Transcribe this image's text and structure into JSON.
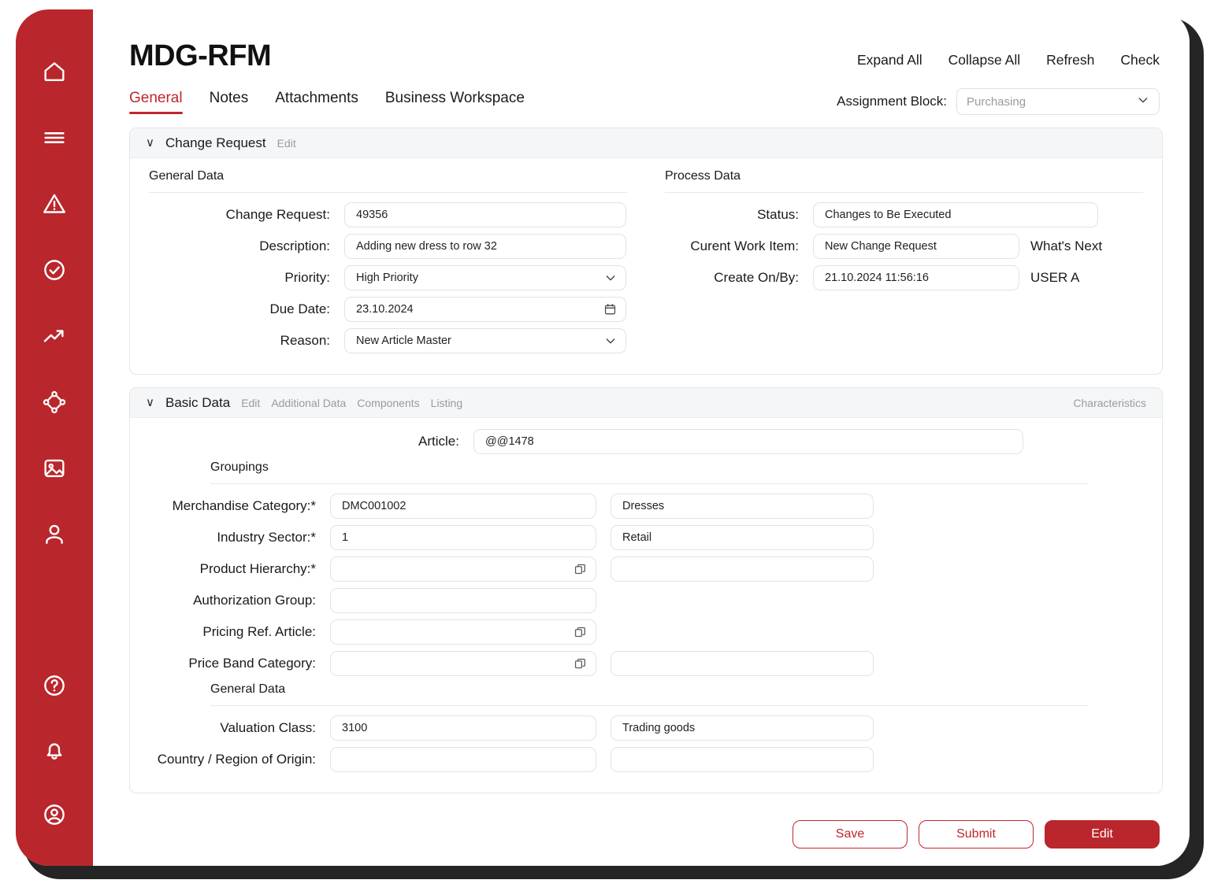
{
  "app": {
    "title": "MDG-RFM",
    "accent_color": "#b9262c",
    "sidebar_color": "#b9262c"
  },
  "sidebar": {
    "top_items": [
      {
        "icon": "home-icon",
        "name": "home"
      },
      {
        "icon": "menu-icon",
        "name": "menu"
      },
      {
        "icon": "warning-triangle-icon",
        "name": "alerts"
      },
      {
        "icon": "check-circle-icon",
        "name": "approvals"
      },
      {
        "icon": "trending-up-icon",
        "name": "analytics"
      },
      {
        "icon": "network-node-icon",
        "name": "hierarchy"
      },
      {
        "icon": "image-icon",
        "name": "media"
      },
      {
        "icon": "person-icon",
        "name": "contacts"
      }
    ],
    "bottom_items": [
      {
        "icon": "help-circle-icon",
        "name": "help"
      },
      {
        "icon": "bell-icon",
        "name": "notifications"
      },
      {
        "icon": "account-circle-icon",
        "name": "account"
      }
    ]
  },
  "header": {
    "actions": [
      {
        "label": "Expand All"
      },
      {
        "label": "Collapse All"
      },
      {
        "label": "Refresh"
      },
      {
        "label": "Check"
      }
    ]
  },
  "tabs": [
    {
      "label": "General",
      "active": true
    },
    {
      "label": "Notes",
      "active": false
    },
    {
      "label": "Attachments",
      "active": false
    },
    {
      "label": "Business Workspace",
      "active": false
    }
  ],
  "assignment_block": {
    "label": "Assignment Block:",
    "value": "",
    "placeholder": "Purchasing",
    "chevron": "∨"
  },
  "change_request_panel": {
    "chevron": "∨",
    "title": "Change Request",
    "edit_label": "Edit",
    "general_data": {
      "section_title": "General Data",
      "fields": [
        {
          "label": "Change Request:",
          "value": "49356",
          "type": "text",
          "icon": ""
        },
        {
          "label": "Description:",
          "value": "Adding new dress to row 32",
          "type": "text",
          "icon": ""
        },
        {
          "label": "Priority:",
          "value": "High Priority",
          "type": "select",
          "icon": "chevron-down-icon"
        },
        {
          "label": "Due Date:",
          "value": "23.10.2024",
          "type": "date",
          "icon": "calendar-icon"
        },
        {
          "label": "Reason:",
          "value": "New Article Master",
          "type": "select",
          "icon": "chevron-down-icon"
        }
      ]
    },
    "process_data": {
      "section_title": "Process Data",
      "fields": [
        {
          "label": "Status:",
          "value": "Changes to Be Executed",
          "suffix": "",
          "short": false
        },
        {
          "label": "Curent Work Item:",
          "value": "New Change Request",
          "suffix": "What's Next",
          "short": true
        },
        {
          "label": "Create On/By:",
          "value": "21.10.2024 11:56:16",
          "suffix": "USER A",
          "short": true
        }
      ]
    }
  },
  "basic_data_panel": {
    "chevron": "∨",
    "title": "Basic Data",
    "links": [
      {
        "label": "Edit"
      },
      {
        "label": "Additional Data"
      },
      {
        "label": "Components"
      },
      {
        "label": "Listing"
      }
    ],
    "right_link": {
      "label": "Characteristics"
    },
    "article": {
      "label": "Article:",
      "value": "@@1478"
    },
    "groupings": {
      "section_title": "Groupings",
      "rows": [
        {
          "label": "Merchandise Category:*",
          "code": "DMC001002",
          "desc": "Dresses",
          "has_desc": true,
          "icon": ""
        },
        {
          "label": "Industry Sector:*",
          "code": "1",
          "desc": "Retail",
          "has_desc": true,
          "icon": ""
        },
        {
          "label": "Product Hierarchy:*",
          "code": "",
          "desc": "",
          "has_desc": true,
          "icon": "copy-icon"
        },
        {
          "label": "Authorization Group:",
          "code": "",
          "desc": "",
          "has_desc": false,
          "icon": ""
        },
        {
          "label": "Pricing Ref. Article:",
          "code": "",
          "desc": "",
          "has_desc": false,
          "icon": "copy-icon"
        },
        {
          "label": "Price Band Category:",
          "code": "",
          "desc": "",
          "has_desc": true,
          "icon": "copy-icon"
        }
      ]
    },
    "general_data": {
      "section_title": "General Data",
      "rows": [
        {
          "label": "Valuation Class:",
          "code": "3100",
          "desc": "Trading goods",
          "has_desc": true,
          "icon": ""
        },
        {
          "label": "Country / Region of Origin:",
          "code": "",
          "desc": "",
          "has_desc": true,
          "icon": ""
        }
      ]
    }
  },
  "footer": {
    "buttons": [
      {
        "label": "Save",
        "style": "outline"
      },
      {
        "label": "Submit",
        "style": "outline"
      },
      {
        "label": "Edit",
        "style": "solid"
      }
    ]
  }
}
